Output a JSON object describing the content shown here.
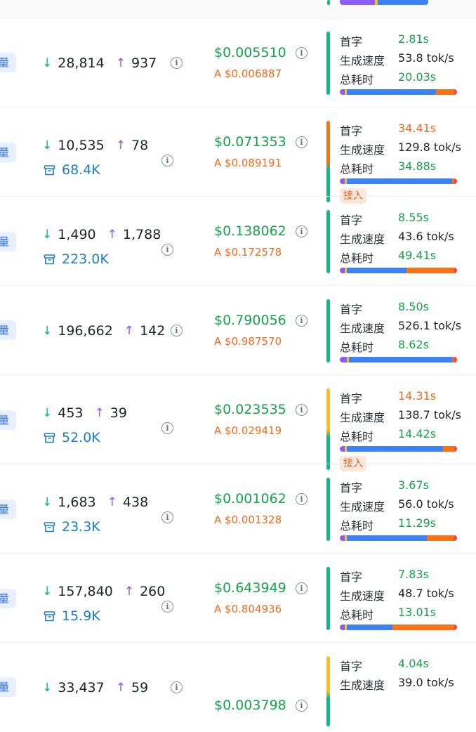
{
  "labels": {
    "tag": "量",
    "first_token": "首字",
    "gen_speed": "生成速度",
    "total_time": "总耗时",
    "a_prefix": "A",
    "join_badge": "接入"
  },
  "colors": {
    "accent_green": "#10b981",
    "accent_orange_top": "#f97316",
    "accent_yellow_top": "#fbbf24",
    "bar_purple": "#8b5cf6",
    "bar_yellow": "#fbbf24",
    "bar_green": "#22c55e",
    "bar_blue": "#3b82f6",
    "bar_orange": "#f97316",
    "bar_red": "#ef4444"
  },
  "rows": [
    {
      "input": "28,814",
      "output": "937",
      "cache": null,
      "price": "$0.005510",
      "a_price": "$0.006887",
      "first_token": "2.81s",
      "first_token_status": "green",
      "speed": "53.8 tok/s",
      "total": "20.03s",
      "accent": "green",
      "badge": false,
      "bar": [
        0.04,
        0.02,
        0.78,
        0.16
      ]
    },
    {
      "input": "10,535",
      "output": "78",
      "cache": "68.4K",
      "price": "$0.071353",
      "a_price": "$0.089191",
      "first_token": "34.41s",
      "first_token_status": "orange",
      "speed": "129.8 tok/s",
      "total": "34.88s",
      "accent": "orange",
      "badge": true,
      "bar": [
        0.04,
        0.02,
        0.92,
        0.02
      ]
    },
    {
      "input": "1,490",
      "output": "1,788",
      "cache": "223.0K",
      "price": "$0.138062",
      "a_price": "$0.172578",
      "first_token": "8.55s",
      "first_token_status": "green",
      "speed": "43.6 tok/s",
      "total": "49.41s",
      "accent": "green",
      "badge": false,
      "bar": [
        0.04,
        0.02,
        0.52,
        0.42
      ]
    },
    {
      "input": "196,662",
      "output": "142",
      "cache": null,
      "price": "$0.790056",
      "a_price": "$0.987570",
      "first_token": "8.50s",
      "first_token_status": "green",
      "speed": "526.1 tok/s",
      "total": "8.62s",
      "accent": "green",
      "badge": false,
      "bar": [
        0.06,
        0.02,
        0.9,
        0.02
      ]
    },
    {
      "input": "453",
      "output": "39",
      "cache": "52.0K",
      "price": "$0.023535",
      "a_price": "$0.029419",
      "first_token": "14.31s",
      "first_token_status": "orange",
      "speed": "138.7 tok/s",
      "total": "14.42s",
      "accent": "yellow",
      "badge": true,
      "bar": [
        0.04,
        0.02,
        0.84,
        0.1
      ]
    },
    {
      "input": "1,683",
      "output": "438",
      "cache": "23.3K",
      "price": "$0.001062",
      "a_price": "$0.001328",
      "first_token": "3.67s",
      "first_token_status": "green",
      "speed": "56.0 tok/s",
      "total": "11.29s",
      "accent": "green",
      "badge": false,
      "bar": [
        0.04,
        0.02,
        0.7,
        0.24
      ]
    },
    {
      "input": "157,840",
      "output": "260",
      "cache": "15.9K",
      "price": "$0.643949",
      "a_price": "$0.804936",
      "first_token": "7.83s",
      "first_token_status": "green",
      "speed": "48.7 tok/s",
      "total": "13.01s",
      "accent": "green",
      "badge": false,
      "bar": [
        0.04,
        0.02,
        0.4,
        0.54
      ]
    },
    {
      "input": "33,437",
      "output": "59",
      "cache": null,
      "price": "$0.003798",
      "a_price": "",
      "first_token": "4.04s",
      "first_token_status": "green",
      "speed": "39.0 tok/s",
      "total": "",
      "accent": "yellow",
      "badge": false,
      "bar": null
    }
  ]
}
